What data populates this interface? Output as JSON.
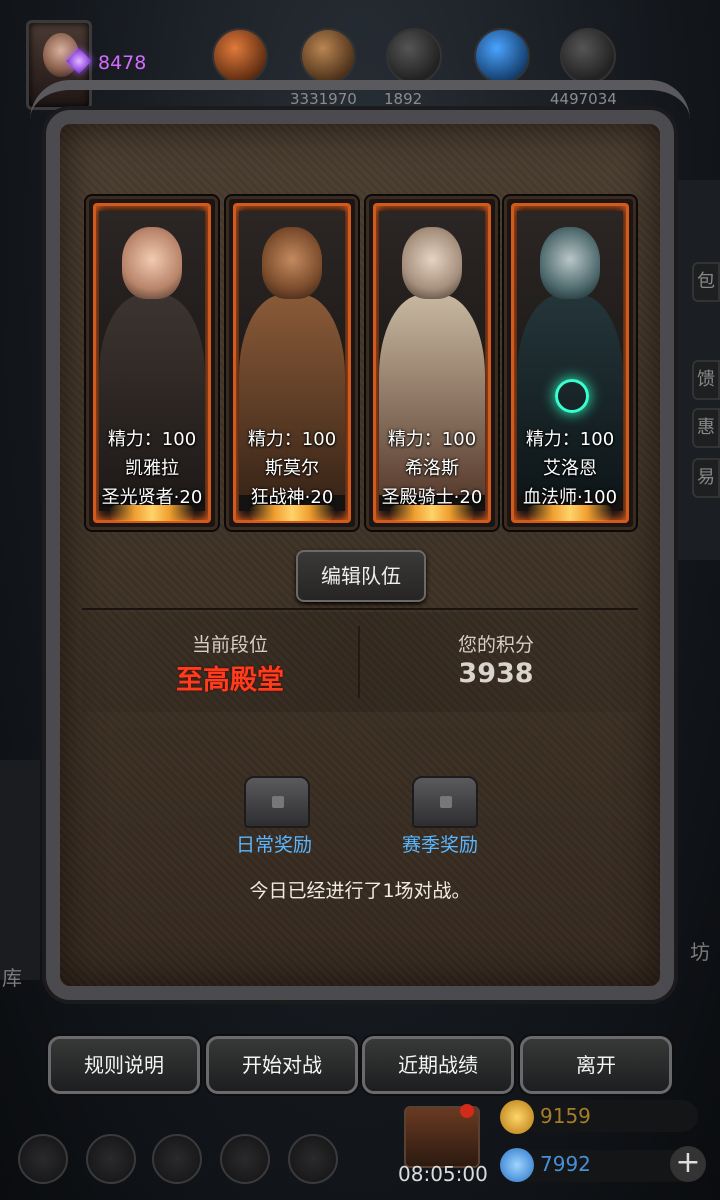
{
  "player": {
    "gem_count": "8478"
  },
  "resources": [
    "",
    "3331970",
    "1892",
    "",
    "4497034"
  ],
  "side_tabs": [
    "包",
    "馈",
    "惠",
    "易"
  ],
  "edge_left": "库",
  "edge_right": "坊",
  "cards": [
    {
      "stamina": "精力：100",
      "name": "凯雅拉",
      "class_level": "圣光贤者·20"
    },
    {
      "stamina": "精力：100",
      "name": "斯莫尔",
      "class_level": "狂战神·20"
    },
    {
      "stamina": "精力：100",
      "name": "希洛斯",
      "class_level": "圣殿骑士·20"
    },
    {
      "stamina": "精力：100",
      "name": "艾洛恩",
      "class_level": "血法师·100"
    }
  ],
  "edit_team_label": "编辑队伍",
  "rank": {
    "tier_label": "当前段位",
    "tier_value": "至高殿堂",
    "points_label": "您的积分",
    "points_value": "3938"
  },
  "rewards": {
    "daily_label": "日常奖励",
    "season_label": "赛季奖励"
  },
  "battle_note": "今日已经进行了1场对战。",
  "buttons": {
    "rules": "规则说明",
    "start": "开始对战",
    "recent": "近期战绩",
    "leave": "离开"
  },
  "footer": {
    "timer": "08:05:00",
    "gold": "9159",
    "diamonds": "7992",
    "plus": "+"
  },
  "colors": {
    "tier": "#ff3c1c",
    "reward_link": "#5ab6ff",
    "gem": "#d46bff",
    "card_glow": "#d35a1a"
  }
}
